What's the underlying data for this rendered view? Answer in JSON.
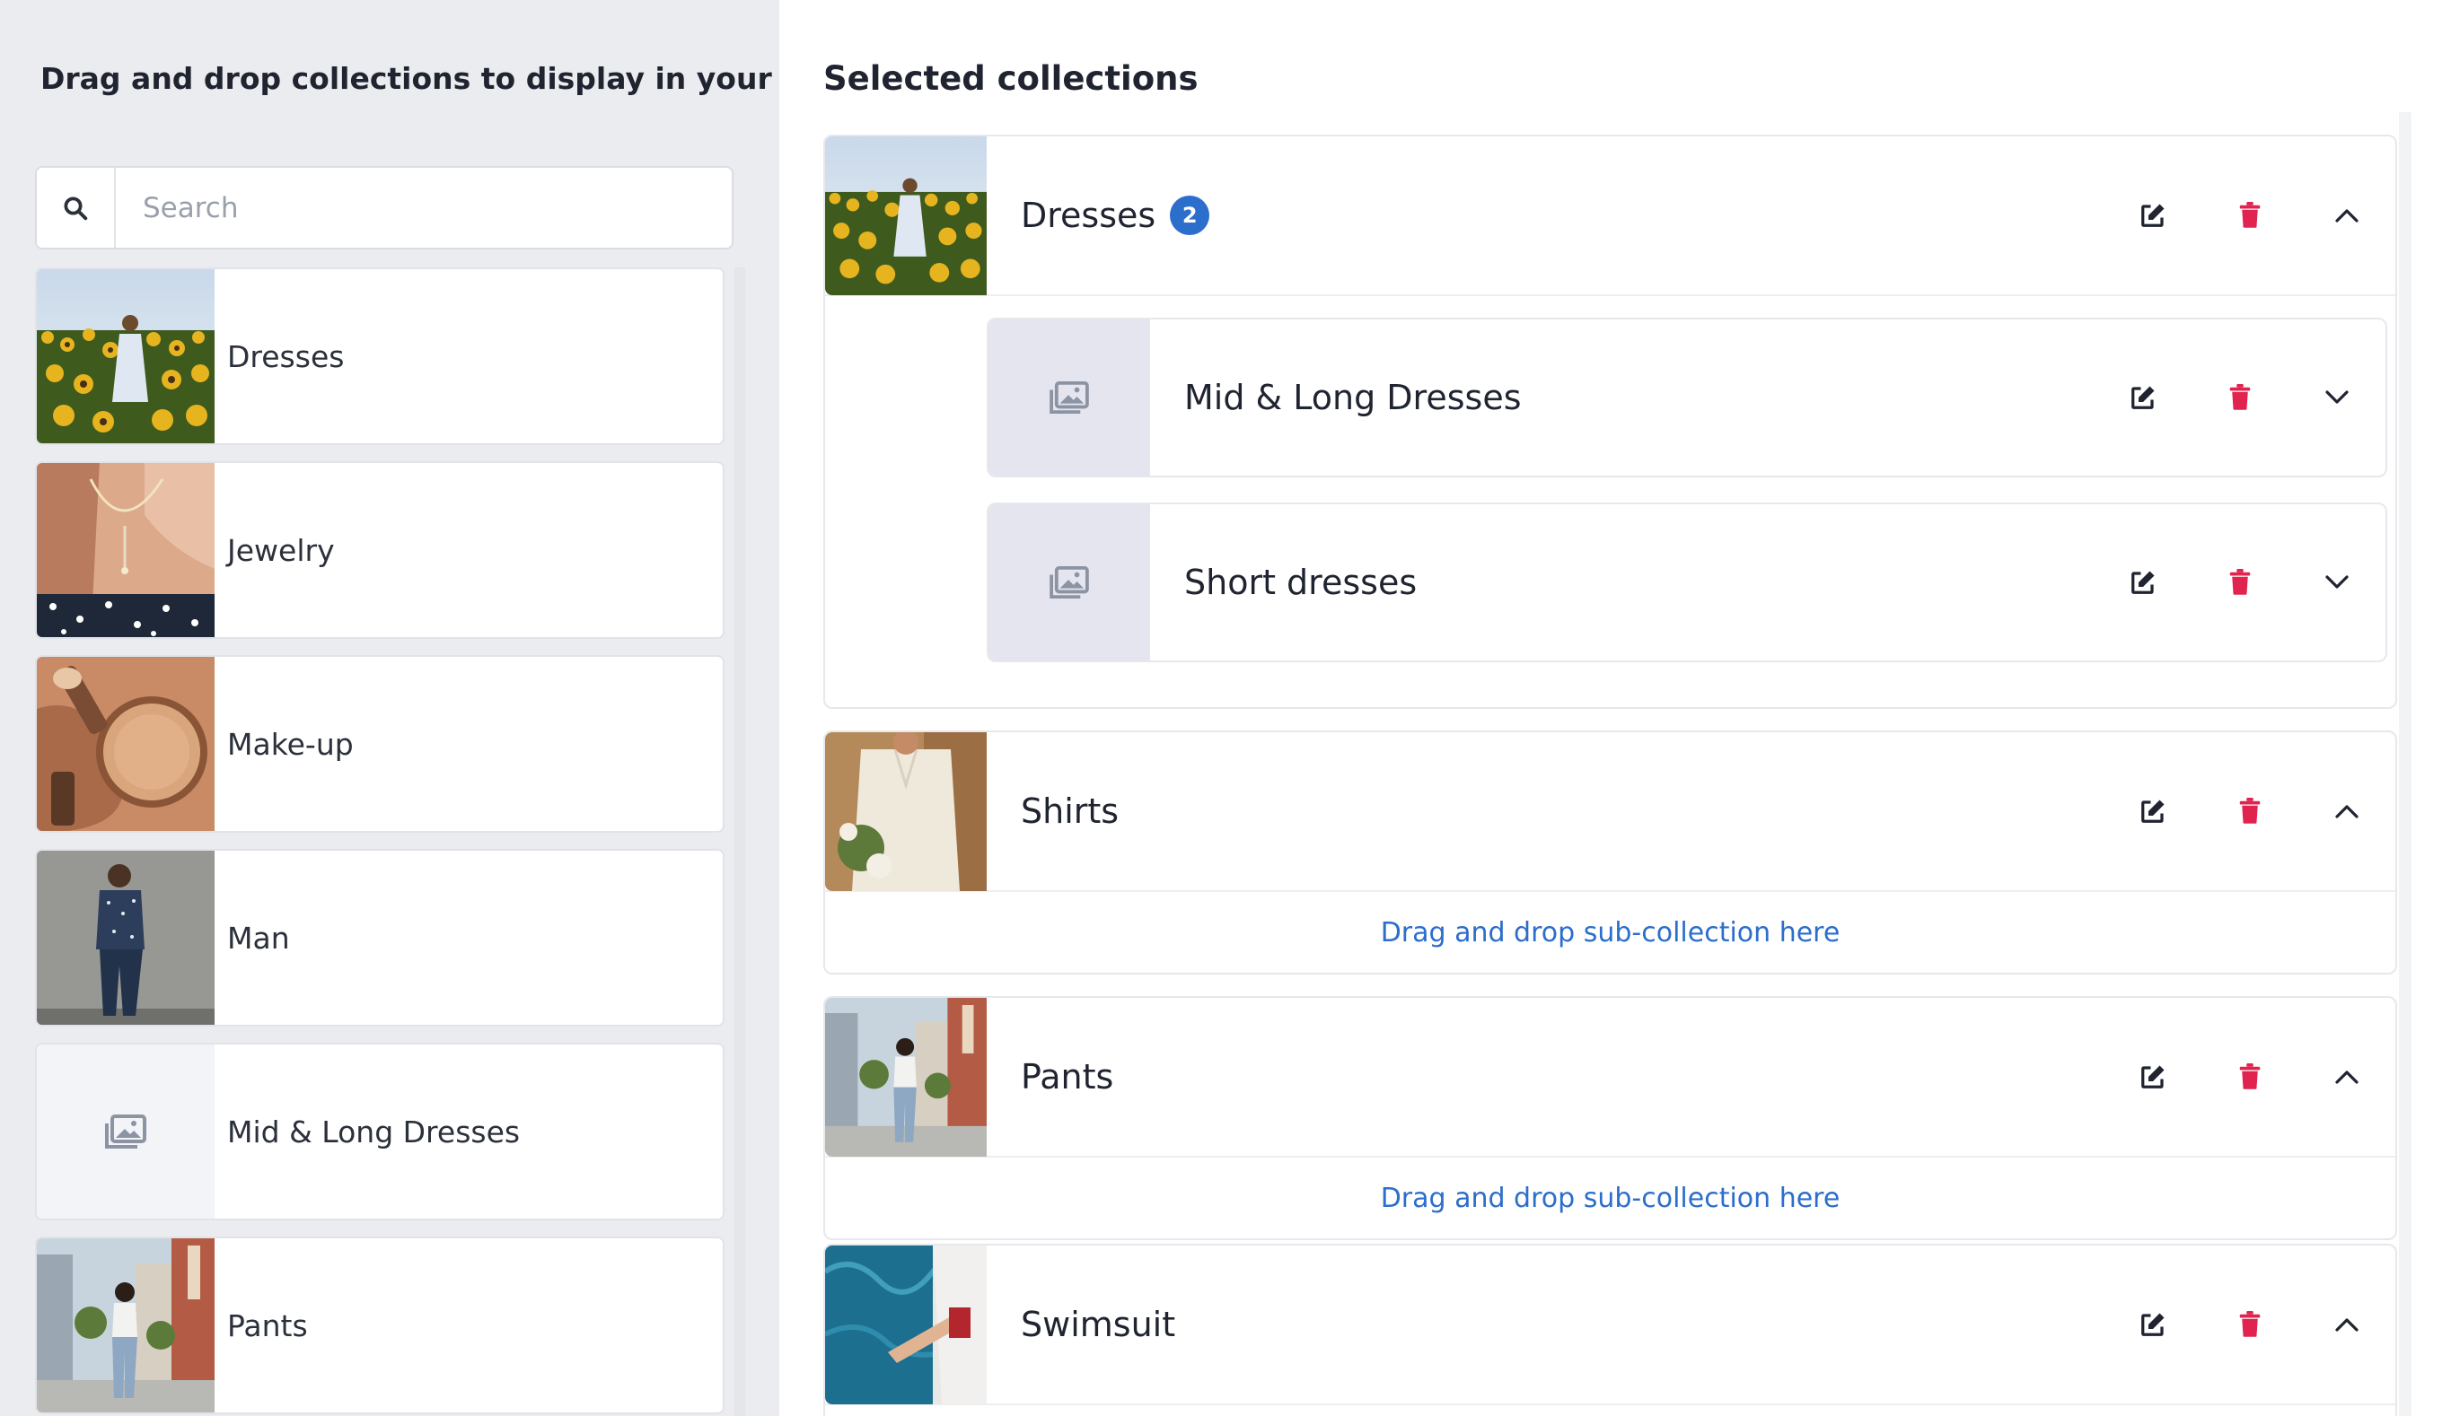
{
  "left_panel": {
    "title": "Drag and drop collections to display in your App",
    "search": {
      "placeholder": "Search",
      "value": ""
    },
    "items": [
      {
        "label": "Dresses",
        "thumb": "sunflower-field"
      },
      {
        "label": "Jewelry",
        "thumb": "necklace"
      },
      {
        "label": "Make-up",
        "thumb": "makeup-brushes"
      },
      {
        "label": "Man",
        "thumb": "man-wall"
      },
      {
        "label": "Mid & Long Dresses",
        "thumb": "placeholder"
      },
      {
        "label": "Pants",
        "thumb": "street"
      }
    ]
  },
  "right_panel": {
    "title": "Selected collections",
    "groups": [
      {
        "name": "Dresses",
        "badge": "2",
        "thumb": "sunflower-field",
        "expanded_icon": "chevron-up-icon",
        "children": [
          {
            "name": "Mid & Long Dresses",
            "thumb": "placeholder",
            "expand_icon": "chevron-down-icon"
          },
          {
            "name": "Short dresses",
            "thumb": "placeholder",
            "expand_icon": "chevron-down-icon"
          }
        ]
      },
      {
        "name": "Shirts",
        "thumb": "shirt",
        "expanded_icon": "chevron-up-icon",
        "drop_hint": "Drag and drop sub-collection here"
      },
      {
        "name": "Pants",
        "thumb": "street",
        "expanded_icon": "chevron-up-icon",
        "drop_hint": "Drag and drop sub-collection here"
      },
      {
        "name": "Swimsuit",
        "thumb": "pool",
        "expanded_icon": "chevron-up-icon"
      }
    ]
  },
  "colors": {
    "accent": "#2c6ecb",
    "delete": "#e0244f",
    "left_bg": "#ebecf0",
    "placeholder_bg": "#e4e5ee"
  }
}
